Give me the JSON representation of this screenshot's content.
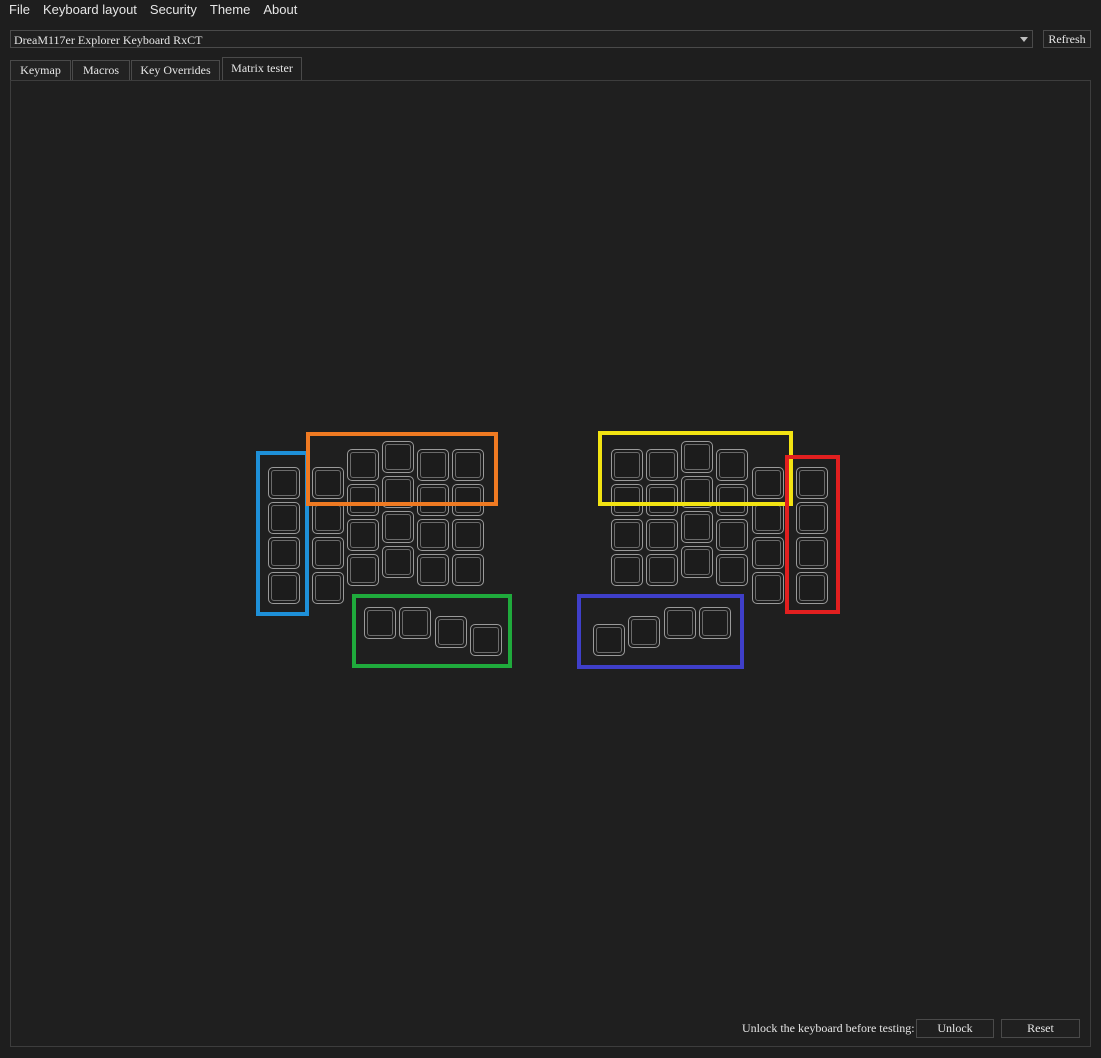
{
  "menu": {
    "file": "File",
    "keyboard_layout": "Keyboard layout",
    "security": "Security",
    "theme": "Theme",
    "about": "About"
  },
  "device": {
    "selected": "DreaM117er Explorer Keyboard RxCT",
    "refresh_label": "Refresh"
  },
  "tabs": {
    "keymap": "Keymap",
    "macros": "Macros",
    "key_overrides": "Key Overrides",
    "matrix_tester": "Matrix tester",
    "active": "Matrix tester"
  },
  "highlight_colors": {
    "blue": "#1e90d8",
    "orange": "#ef7a22",
    "green": "#1faa3c",
    "yellow": "#f2e312",
    "red": "#e11f1f",
    "indigo": "#3f3fc9"
  },
  "footer": {
    "message": "Unlock the keyboard before testing:",
    "unlock_label": "Unlock",
    "reset_label": "Reset"
  }
}
